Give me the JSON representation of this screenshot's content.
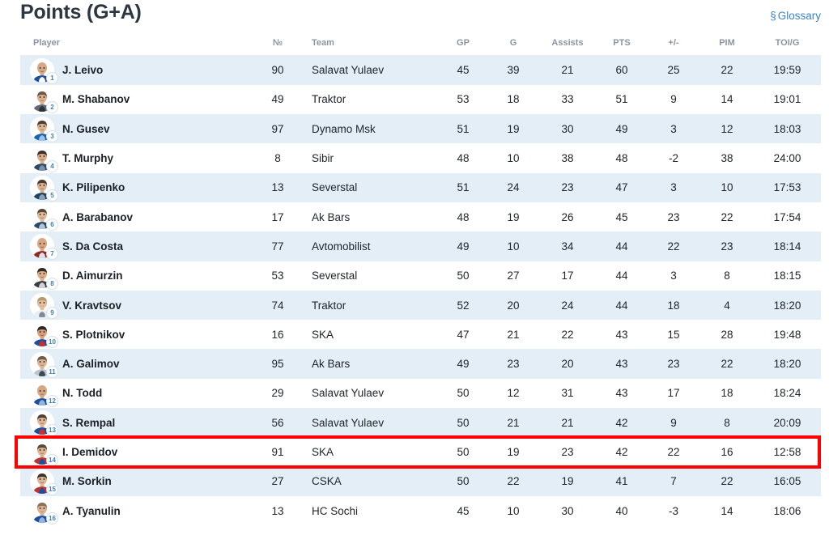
{
  "header": {
    "title": "Points (G+A)",
    "glossary": {
      "symbol": "§",
      "label": "Glossary"
    }
  },
  "table": {
    "columns": [
      {
        "key": "player",
        "label": "Player"
      },
      {
        "key": "number",
        "label": "№"
      },
      {
        "key": "team",
        "label": "Team"
      },
      {
        "key": "gp",
        "label": "GP"
      },
      {
        "key": "g",
        "label": "G"
      },
      {
        "key": "assists",
        "label": "Assists"
      },
      {
        "key": "pts",
        "label": "PTS"
      },
      {
        "key": "plusminus",
        "label": "+/-"
      },
      {
        "key": "pim",
        "label": "PIM"
      },
      {
        "key": "toig",
        "label": "TOI/G"
      }
    ],
    "rows": [
      {
        "rank": "1",
        "player": "J. Leivo",
        "number": "90",
        "team": "Salavat Yulaev",
        "gp": "45",
        "g": "39",
        "assists": "21",
        "pts": "60",
        "plusminus": "25",
        "pim": "22",
        "toig": "19:59",
        "highlighted": false
      },
      {
        "rank": "2",
        "player": "M. Shabanov",
        "number": "49",
        "team": "Traktor",
        "gp": "53",
        "g": "18",
        "assists": "33",
        "pts": "51",
        "plusminus": "9",
        "pim": "14",
        "toig": "19:01",
        "highlighted": false
      },
      {
        "rank": "3",
        "player": "N. Gusev",
        "number": "97",
        "team": "Dynamo Msk",
        "gp": "51",
        "g": "19",
        "assists": "30",
        "pts": "49",
        "plusminus": "3",
        "pim": "12",
        "toig": "18:03",
        "highlighted": false
      },
      {
        "rank": "4",
        "player": "T. Murphy",
        "number": "8",
        "team": "Sibir",
        "gp": "48",
        "g": "10",
        "assists": "38",
        "pts": "48",
        "plusminus": "-2",
        "pim": "38",
        "toig": "24:00",
        "highlighted": false
      },
      {
        "rank": "5",
        "player": "K. Pilipenko",
        "number": "13",
        "team": "Severstal",
        "gp": "51",
        "g": "24",
        "assists": "23",
        "pts": "47",
        "plusminus": "3",
        "pim": "10",
        "toig": "17:53",
        "highlighted": false
      },
      {
        "rank": "6",
        "player": "A. Barabanov",
        "number": "17",
        "team": "Ak Bars",
        "gp": "48",
        "g": "19",
        "assists": "26",
        "pts": "45",
        "plusminus": "23",
        "pim": "22",
        "toig": "17:54",
        "highlighted": false
      },
      {
        "rank": "7",
        "player": "S. Da Costa",
        "number": "77",
        "team": "Avtomobilist",
        "gp": "49",
        "g": "10",
        "assists": "34",
        "pts": "44",
        "plusminus": "22",
        "pim": "23",
        "toig": "18:14",
        "highlighted": false
      },
      {
        "rank": "8",
        "player": "D. Aimurzin",
        "number": "53",
        "team": "Severstal",
        "gp": "50",
        "g": "27",
        "assists": "17",
        "pts": "44",
        "plusminus": "3",
        "pim": "8",
        "toig": "18:15",
        "highlighted": false
      },
      {
        "rank": "9",
        "player": "V. Kravtsov",
        "number": "74",
        "team": "Traktor",
        "gp": "52",
        "g": "20",
        "assists": "24",
        "pts": "44",
        "plusminus": "18",
        "pim": "4",
        "toig": "18:20",
        "highlighted": false
      },
      {
        "rank": "10",
        "player": "S. Plotnikov",
        "number": "16",
        "team": "SKA",
        "gp": "47",
        "g": "21",
        "assists": "22",
        "pts": "43",
        "plusminus": "15",
        "pim": "28",
        "toig": "19:48",
        "highlighted": false
      },
      {
        "rank": "11",
        "player": "A. Galimov",
        "number": "95",
        "team": "Ak Bars",
        "gp": "49",
        "g": "23",
        "assists": "20",
        "pts": "43",
        "plusminus": "23",
        "pim": "22",
        "toig": "18:20",
        "highlighted": false
      },
      {
        "rank": "12",
        "player": "N. Todd",
        "number": "29",
        "team": "Salavat Yulaev",
        "gp": "50",
        "g": "12",
        "assists": "31",
        "pts": "43",
        "plusminus": "17",
        "pim": "18",
        "toig": "18:24",
        "highlighted": false
      },
      {
        "rank": "13",
        "player": "S. Rempal",
        "number": "56",
        "team": "Salavat Yulaev",
        "gp": "50",
        "g": "21",
        "assists": "21",
        "pts": "42",
        "plusminus": "9",
        "pim": "8",
        "toig": "20:09",
        "highlighted": false
      },
      {
        "rank": "14",
        "player": "I. Demidov",
        "number": "91",
        "team": "SKA",
        "gp": "50",
        "g": "19",
        "assists": "23",
        "pts": "42",
        "plusminus": "22",
        "pim": "16",
        "toig": "12:58",
        "highlighted": true
      },
      {
        "rank": "15",
        "player": "M. Sorkin",
        "number": "27",
        "team": "CSKA",
        "gp": "50",
        "g": "22",
        "assists": "19",
        "pts": "41",
        "plusminus": "7",
        "pim": "22",
        "toig": "16:05",
        "highlighted": false
      },
      {
        "rank": "16",
        "player": "A. Tyanulin",
        "number": "13",
        "team": "HC Sochi",
        "gp": "45",
        "g": "10",
        "assists": "30",
        "pts": "40",
        "plusminus": "-3",
        "pim": "14",
        "toig": "18:06",
        "highlighted": false
      }
    ]
  },
  "colors": {
    "row_odd": "#e4eef6",
    "row_even": "#ffffff",
    "accent_link": "#3b82c4",
    "highlight_border": "#ff0000",
    "header_text": "#8b95a1",
    "title_text": "#2c3740"
  },
  "avatar_palettes": [
    {
      "skin": "#d8a886",
      "hair": "#3b3228",
      "jersey": "#1f4f9c",
      "jersey2": "#ffffff",
      "bald": true
    },
    {
      "skin": "#dcb08f",
      "hair": "#6b5a46",
      "jersey": "#5f6a72",
      "jersey2": "#2d3339",
      "bald": false
    },
    {
      "skin": "#e0b593",
      "hair": "#4a3f33",
      "jersey": "#1b63ad",
      "jersey2": "#9dc4e6",
      "bald": false
    },
    {
      "skin": "#dcae8c",
      "hair": "#3a3028",
      "jersey": "#2f4a63",
      "jersey2": "#7b93a8",
      "bald": false
    },
    {
      "skin": "#dcb191",
      "hair": "#4b3c2e",
      "jersey": "#26435c",
      "jersey2": "#88a4bb",
      "bald": false
    },
    {
      "skin": "#e2b996",
      "hair": "#5a4836",
      "jersey": "#2b4a66",
      "jersey2": "#b0c6d8",
      "bald": false
    },
    {
      "skin": "#d9a583",
      "hair": "#2f2a25",
      "jersey": "#8f2a2a",
      "jersey2": "#e2e2e2",
      "bald": true
    },
    {
      "skin": "#dcae8c",
      "hair": "#332b23",
      "jersey": "#3a3f45",
      "jersey2": "#d0d4d8",
      "bald": false
    },
    {
      "skin": "#e4bd9b",
      "hair": "#b69a6d",
      "jersey": "#e8eef3",
      "jersey2": "#7d8b97",
      "bald": false
    },
    {
      "skin": "#d6a07e",
      "hair": "#2e2823",
      "jersey": "#1f4f9c",
      "jersey2": "#c0342f",
      "bald": false
    },
    {
      "skin": "#ddb392",
      "hair": "#6d5c47",
      "jersey": "#b9c4cc",
      "jersey2": "#3c4a55",
      "bald": false
    },
    {
      "skin": "#d9a683",
      "hair": "#443a30",
      "jersey": "#1f4f9c",
      "jersey2": "#8fb6dd",
      "bald": true
    },
    {
      "skin": "#e0b795",
      "hair": "#4c4034",
      "jersey": "#1f4f9c",
      "jersey2": "#c0342f",
      "bald": false
    },
    {
      "skin": "#ddb392",
      "hair": "#574938",
      "jersey": "#c0342f",
      "jersey2": "#1f4f9c",
      "bald": false
    },
    {
      "skin": "#e0b795",
      "hair": "#3d342b",
      "jersey": "#c0342f",
      "jersey2": "#1f4f9c",
      "bald": false
    },
    {
      "skin": "#ddb392",
      "hair": "#8a7354",
      "jersey": "#1f4f9c",
      "jersey2": "#8fb6dd",
      "bald": false
    }
  ]
}
